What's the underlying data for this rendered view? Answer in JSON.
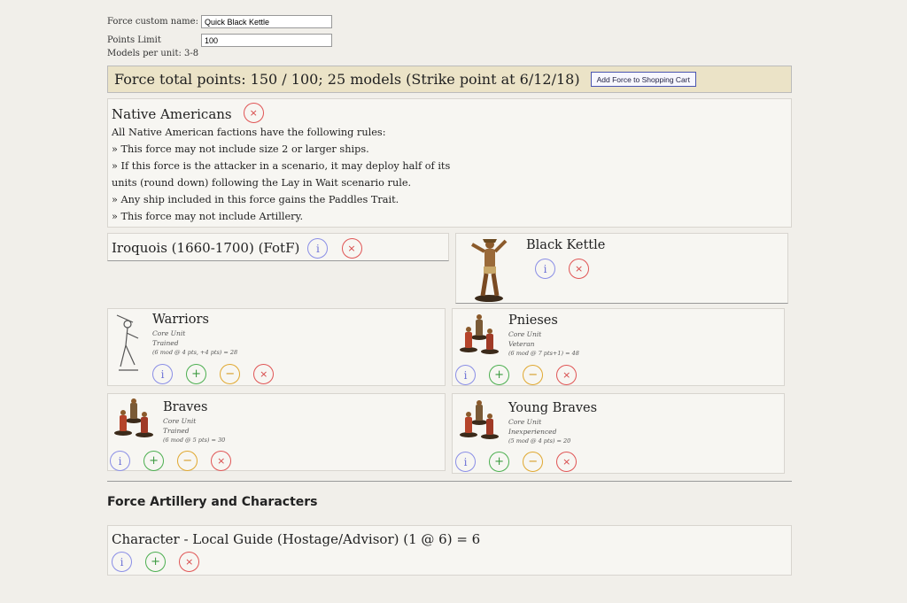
{
  "form": {
    "name_label": "Force custom name:",
    "name_value": "Quick Black Kettle",
    "points_label": "Points Limit",
    "points_value": "100",
    "models_label": "Models per unit: 3-8"
  },
  "total": {
    "text": "Force total points: 150 / 100; 25 models (Strike point at 6/12/18)",
    "cart_button": "Add Force to Shopping Cart"
  },
  "faction": {
    "title": "Native Americans",
    "rules": [
      "All Native American factions have the following rules:",
      "» This force may not include size 2 or larger ships.",
      "» If this force is the attacker in a scenario, it may deploy half of its",
      "units (round down) following the Lay in Wait scenario rule.",
      "» Any ship included in this force gains the Paddles Trait.",
      "» This force may not include Artillery."
    ]
  },
  "subfaction": {
    "title": "Iroquois (1660-1700) (FotF)"
  },
  "commander": {
    "name": "Black Kettle"
  },
  "units": [
    {
      "name": "Warriors",
      "type": "Core Unit",
      "exp": "Trained",
      "cost": "(6 mod @ 4 pts, +4 pts) = 28"
    },
    {
      "name": "Pnieses",
      "type": "Core Unit",
      "exp": "Veteran",
      "cost": "(6 mod @ 7 pts+1) = 48"
    },
    {
      "name": "Braves",
      "type": "Core Unit",
      "exp": "Trained",
      "cost": "(6 mod @ 5 pts) = 30"
    },
    {
      "name": "Young Braves",
      "type": "Core Unit",
      "exp": "Inexperienced",
      "cost": "(5 mod @ 4 pts) = 20"
    }
  ],
  "artillery_section": {
    "title": "Force Artillery and Characters"
  },
  "character": {
    "text": "Character - Local Guide (Hostage/Advisor) (1 @ 6) = 6"
  },
  "icons": {
    "info": "i",
    "add": "+",
    "sub": "−",
    "del": "×"
  },
  "colors": {
    "background": "#f1efea",
    "total_bar": "#ebe3c7",
    "info": "#6b70d6",
    "add": "#3d9a41",
    "sub": "#d49a20",
    "del": "#d64545"
  }
}
